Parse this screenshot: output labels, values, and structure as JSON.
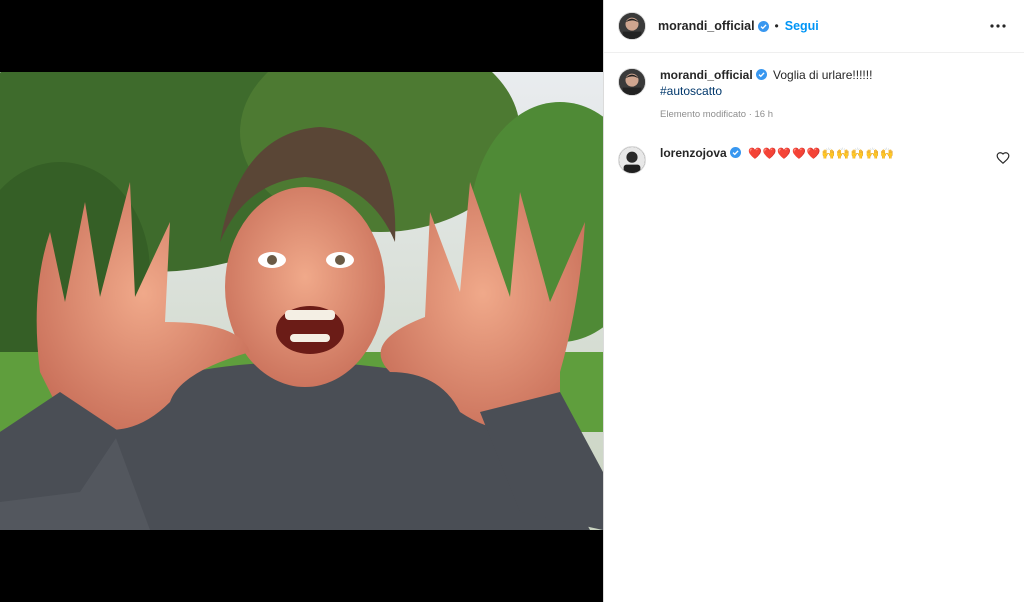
{
  "post": {
    "author": {
      "username": "morandi_official",
      "verified": true,
      "follow_label": "Segui"
    },
    "more_icon": "more-horizontal-icon",
    "caption": {
      "username": "morandi_official",
      "text": "Voglia di urlare!!!!!!",
      "hashtag": "#autoscatto",
      "meta": "Elemento modificato · 16 h"
    },
    "comments": [
      {
        "username": "lorenzojova",
        "verified": true,
        "text": "❤️❤️❤️❤️❤️🙌🙌🙌🙌🙌"
      }
    ]
  },
  "colors": {
    "accent": "#0095f6",
    "verified": "#3897f0",
    "hashtag": "#00376b",
    "muted": "#8e8e8e"
  }
}
